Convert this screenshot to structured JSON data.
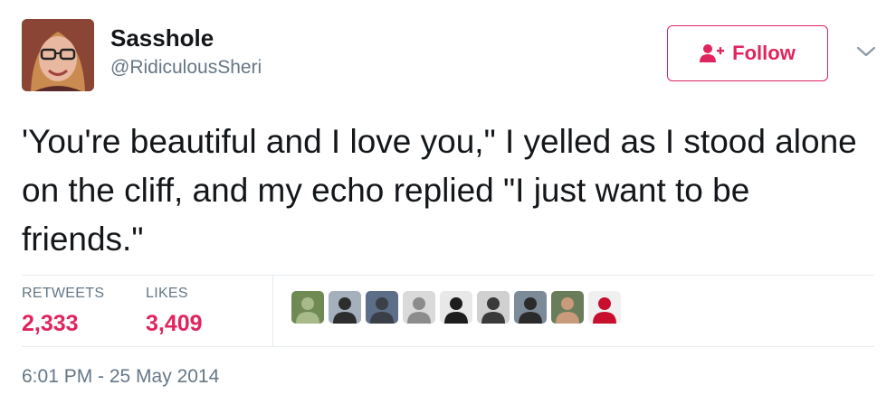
{
  "user": {
    "display_name": "Sasshole",
    "handle": "@RidiculousSheri",
    "avatar_icon": "profile-photo"
  },
  "follow": {
    "label": "Follow",
    "icon": "add-user-icon",
    "accent": "#e0245e"
  },
  "menu": {
    "icon": "chevron-down-icon"
  },
  "tweet": {
    "text": "'You're beautiful and I love you,\" I yelled as I stood alone on the cliff, and my echo replied \"I just want to be friends.\""
  },
  "stats": {
    "retweets_label": "RETWEETS",
    "retweets_value": "2,333",
    "likes_label": "LIKES",
    "likes_value": "3,409"
  },
  "likers": [
    {
      "name": "liker-avatar-1",
      "bg": "#6f8a53",
      "fg": "#a8b98a"
    },
    {
      "name": "liker-avatar-2",
      "bg": "#a5b0bd",
      "fg": "#2d2d2d"
    },
    {
      "name": "liker-avatar-3",
      "bg": "#5c6e88",
      "fg": "#3a3f48"
    },
    {
      "name": "liker-avatar-4",
      "bg": "#dadada",
      "fg": "#8c8c8c"
    },
    {
      "name": "liker-avatar-5",
      "bg": "#e8e8e8",
      "fg": "#1d1d1d"
    },
    {
      "name": "liker-avatar-6",
      "bg": "#d0d0d0",
      "fg": "#3a3a3a"
    },
    {
      "name": "liker-avatar-7",
      "bg": "#7d8b99",
      "fg": "#2b2b2b"
    },
    {
      "name": "liker-avatar-8",
      "bg": "#6a7d5a",
      "fg": "#c99a7b"
    },
    {
      "name": "liker-avatar-9",
      "bg": "#f0f0f0",
      "fg": "#c8102e"
    }
  ],
  "timestamp": "6:01 PM - 25 May 2014",
  "colors": {
    "text": "#14171a",
    "secondary": "#657786",
    "divider": "#e6ecf0",
    "likes": "#e0245e"
  }
}
